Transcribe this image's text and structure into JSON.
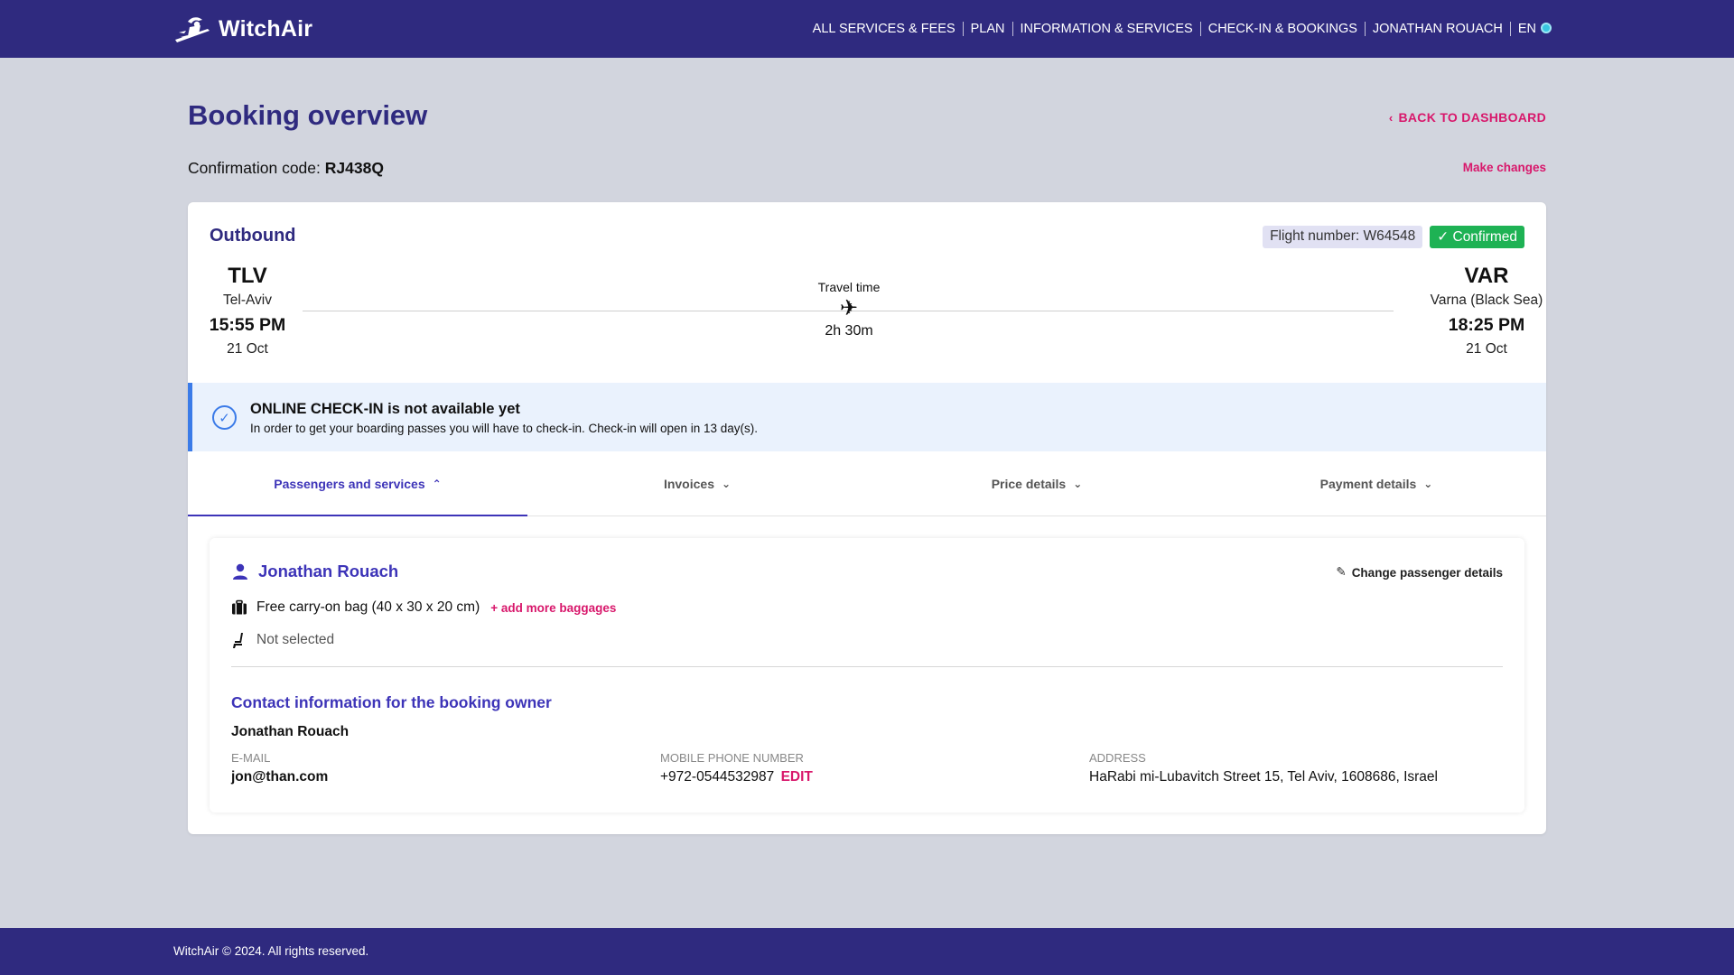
{
  "header": {
    "logo_text": "WitchAir",
    "nav": [
      "ALL SERVICES & FEES",
      "PLAN",
      "INFORMATION & SERVICES",
      "CHECK-IN & BOOKINGS",
      "JONATHAN ROUACH",
      "EN"
    ]
  },
  "page": {
    "title": "Booking overview",
    "back_label": "BACK TO DASHBOARD",
    "confirmation_label": "Confirmation code:",
    "confirmation_code": "RJ438Q",
    "make_changes": "Make changes"
  },
  "flight": {
    "direction": "Outbound",
    "flight_number": "Flight number: W64548",
    "status": "✓ Confirmed",
    "status_color": "#1eb254",
    "from": {
      "code": "TLV",
      "city": "Tel-Aviv",
      "time": "15:55 PM",
      "date": "21 Oct"
    },
    "to": {
      "code": "VAR",
      "city": "Varna (Black Sea)",
      "time": "18:25 PM",
      "date": "21 Oct"
    },
    "travel_label": "Travel time",
    "travel_icon": "airplane-icon",
    "duration": "2h 30m"
  },
  "checkin_notice": {
    "title": "ONLINE CHECK-IN is not available yet",
    "text": "In order to get your boarding passes you will have to check-in. Check-in will open in 13 day(s).",
    "icon": "check-circle-icon"
  },
  "tabs": [
    {
      "label": "Passengers and services",
      "active": true,
      "chevron": "⌃"
    },
    {
      "label": "Invoices",
      "active": false,
      "chevron": "⌄"
    },
    {
      "label": "Price details",
      "active": false,
      "chevron": "⌄"
    },
    {
      "label": "Payment details",
      "active": false,
      "chevron": "⌄"
    }
  ],
  "passenger": {
    "name": "Jonathan Rouach",
    "change_label": "Change passenger details",
    "baggage": "Free carry-on bag (40 x 30 x 20 cm)",
    "add_baggage": "+ add more baggages",
    "seat": "Not selected"
  },
  "contact": {
    "title": "Contact information for the booking owner",
    "name": "Jonathan Rouach",
    "email_label": "E-MAIL",
    "email": "jon@than.com",
    "phone_label": "MOBILE PHONE NUMBER",
    "phone": "+972-0544532987",
    "phone_edit": "EDIT",
    "address_label": "ADDRESS",
    "address": "HaRabi mi-Lubavitch Street 15, Tel Aviv, 1608686, Israel"
  },
  "footer": {
    "text": "WitchAir © 2024. All rights reserved."
  },
  "colors": {
    "brand": "#2f2a7f",
    "accent": "#d8176b",
    "link": "#3d34b8",
    "info": "#3b7be8"
  }
}
